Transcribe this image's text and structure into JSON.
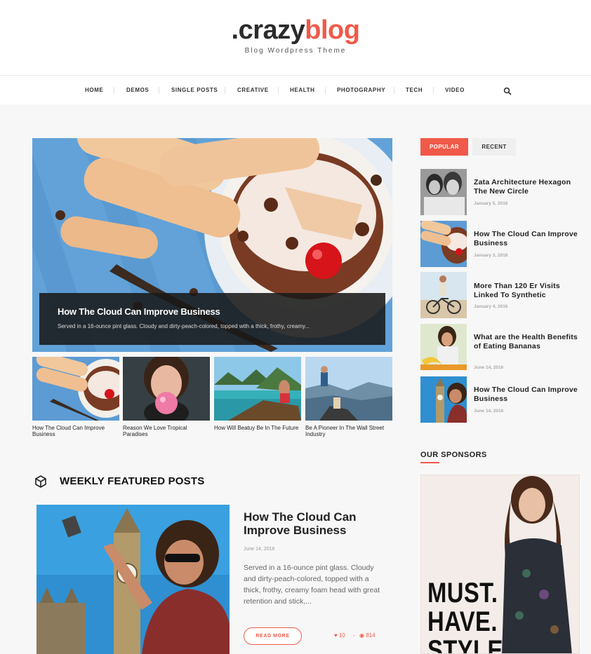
{
  "brand": {
    "logo_dark": ".crazy",
    "logo_red": "blog",
    "tagline": "Blog Wordpress Theme"
  },
  "nav": {
    "items": [
      "HOME",
      "DEMOS",
      "SINGLE POSTS",
      "CREATIVE",
      "HEALTH",
      "PHOTOGRAPHY",
      "TECH",
      "VIDEO"
    ],
    "search_icon": "search-icon"
  },
  "hero": {
    "title": "How The Cloud Can Improve Business",
    "excerpt": "Served in a 16-ounce pint glass. Cloudy and dirty-peach-colored, topped with a thick, frothy, creamy..."
  },
  "thumbs": [
    {
      "caption": "How The Cloud Can Improve Business"
    },
    {
      "caption": "Reason We Love Tropical Paradises"
    },
    {
      "caption": "How Will Beatuy Be In The Future"
    },
    {
      "caption": "Be A Pioneer In The Wall Street Industry"
    }
  ],
  "weekly": {
    "heading": "WEEKLY FEATURED POSTS",
    "post": {
      "title": "How The Cloud Can Improve Business",
      "date": "June 14, 2016",
      "excerpt": "Served in a 16-ounce pint glass. Cloudy and dirty-peach-colored, topped with a thick, frothy, creamy foam head with great retention and stick,...",
      "read_more": "READ MORE",
      "likes": "10",
      "separator": "-",
      "views": "814"
    }
  },
  "sidebar": {
    "tabs": {
      "popular": "POPULAR",
      "recent": "RECENT"
    },
    "posts": [
      {
        "title": "Zata Architecture Hexagon The New Circle",
        "date": "January 5, 2016"
      },
      {
        "title": "How The Cloud Can Improve Business",
        "date": "January 3, 2016"
      },
      {
        "title": "More Than 120 Er Visits Linked To Synthetic",
        "date": "January 4, 2016"
      },
      {
        "title": "What are the Health Benefits of Eating Bananas",
        "date": "June 14, 2016"
      },
      {
        "title": "How The Cloud Can Improve Business",
        "date": "June 14, 2016"
      }
    ],
    "sponsors_heading": "OUR SPONSORS",
    "ad_text": [
      "MUST.",
      "HAVE.",
      "STYLE."
    ]
  },
  "colors": {
    "accent": "#f05a49",
    "dark": "#2b2b2b",
    "background": "#f7f7f7"
  }
}
